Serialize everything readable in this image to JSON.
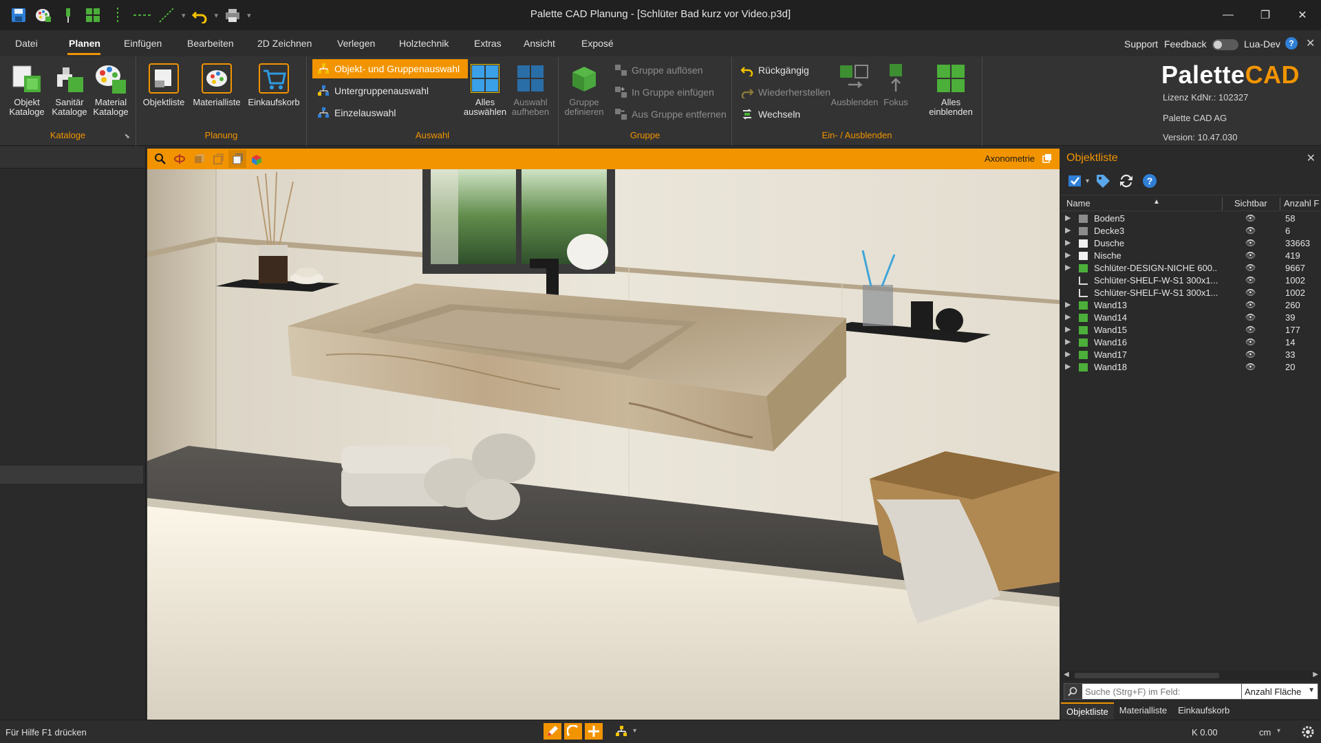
{
  "window": {
    "title": "Palette CAD Planung - [Schlüter Bad kurz vor Video.p3d]",
    "minimize": "—",
    "maximize": "❐",
    "close": "✕"
  },
  "menu": {
    "tabs": [
      "Datei",
      "Planen",
      "Einfügen",
      "Bearbeiten",
      "2D Zeichnen",
      "Verlegen",
      "Holztechnik",
      "Extras",
      "Ansicht",
      "Exposé"
    ],
    "active": "Planen",
    "support": "Support",
    "feedback": "Feedback",
    "lua_dev": "Lua-Dev",
    "help": "?",
    "close": "✕"
  },
  "ribbon": {
    "kataloge": {
      "label": "Kataloge",
      "buttons": [
        "Objekt\nKataloge",
        "Sanitär\nKataloge",
        "Material\nKataloge"
      ]
    },
    "planung": {
      "label": "Planung",
      "buttons": [
        "Objektliste",
        "Materialliste",
        "Einkaufskorb"
      ]
    },
    "auswahl": {
      "label": "Auswahl",
      "small": [
        "Objekt- und Gruppenauswahl",
        "Untergruppenauswahl",
        "Einzelauswahl"
      ],
      "buttons": [
        "Alles\nauswählen",
        "Auswahl\naufheben"
      ]
    },
    "gruppe": {
      "label": "Gruppe",
      "buttons": [
        "Gruppe\ndefinieren"
      ],
      "small": [
        "Gruppe auflösen",
        "In Gruppe einfügen",
        "Aus Gruppe entfernen"
      ]
    },
    "einaus": {
      "label": "Ein- / Ausblenden",
      "small": [
        "Rückgängig",
        "Wiederherstellen",
        "Wechseln"
      ],
      "buttons": [
        "Ausblenden",
        "Fokus",
        "Alles\neinblenden"
      ]
    },
    "brand": {
      "part1": "Palette",
      "part2": "CAD",
      "lizenz": "Lizenz KdNr.: 102327",
      "company": "Palette CAD AG",
      "version": "Version: 10.47.030"
    }
  },
  "viewport": {
    "view_label": "Axonometrie"
  },
  "objektliste": {
    "title": "Objektliste",
    "close": "✕",
    "columns": [
      "Name",
      "Sichtbar",
      "Anzahl F"
    ],
    "rows": [
      {
        "name": "Boden5",
        "count": "58",
        "icon": "floor"
      },
      {
        "name": "Decke3",
        "count": "6",
        "icon": "floor"
      },
      {
        "name": "Dusche",
        "count": "33663",
        "icon": "white"
      },
      {
        "name": "Nische",
        "count": "419",
        "icon": "white"
      },
      {
        "name": "Schlüter-DESIGN-NICHE 600...",
        "count": "9667",
        "icon": "niche"
      },
      {
        "name": "Schlüter-SHELF-W-S1 300x1...",
        "count": "1002",
        "icon": "shelf"
      },
      {
        "name": "Schlüter-SHELF-W-S1 300x1...",
        "count": "1002",
        "icon": "shelf"
      },
      {
        "name": "Wand13",
        "count": "260",
        "icon": "wall"
      },
      {
        "name": "Wand14",
        "count": "39",
        "icon": "wall"
      },
      {
        "name": "Wand15",
        "count": "177",
        "icon": "wall"
      },
      {
        "name": "Wand16",
        "count": "14",
        "icon": "wall"
      },
      {
        "name": "Wand17",
        "count": "33",
        "icon": "wall"
      },
      {
        "name": "Wand18",
        "count": "20",
        "icon": "wall"
      }
    ],
    "eye": "👁",
    "search_placeholder": "Suche (Strg+F) im Feld:",
    "field_combo": "Anzahl Fläche",
    "tabs": [
      "Objektliste",
      "Materialliste",
      "Einkaufskorb"
    ]
  },
  "status": {
    "help_text": "Für Hilfe F1 drücken",
    "k_value": "K 0.00",
    "unit": "cm"
  },
  "colors": {
    "accent": "#f29400",
    "panel": "#2a2a2a",
    "green": "#4caf3a"
  }
}
